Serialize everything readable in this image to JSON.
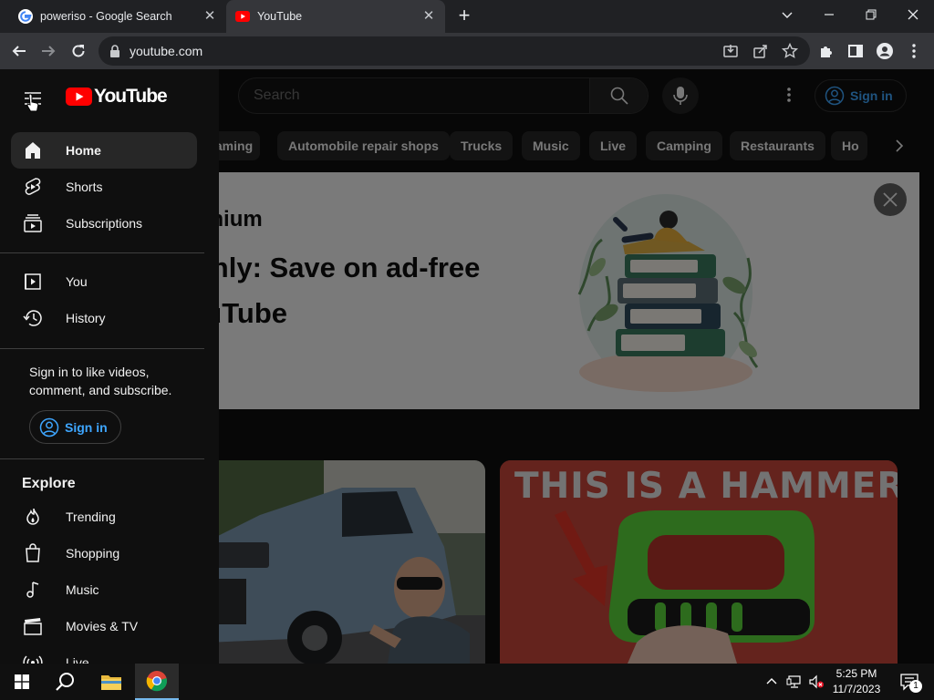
{
  "browser": {
    "tabs": [
      {
        "title": "poweriso - Google Search",
        "favicon": "google-icon"
      },
      {
        "title": "YouTube",
        "favicon": "youtube-icon",
        "active": true
      }
    ],
    "url": "youtube.com"
  },
  "youtube": {
    "logo_text": "YouTube",
    "search_placeholder": "Search",
    "signin_label": "Sign in",
    "chips": [
      "Gaming",
      "Automobile repair shops",
      "Trucks",
      "Music",
      "Live",
      "Camping",
      "Restaurants",
      "Ho"
    ],
    "banner": {
      "brand": "Premium",
      "headline": "s only: Save on ad-free YouTube"
    },
    "thumbnails": [
      {
        "caption": ""
      },
      {
        "caption": "THIS IS A HAMMER"
      }
    ]
  },
  "sidebar": {
    "primary": [
      {
        "label": "Home",
        "icon": "home-icon",
        "active": true
      },
      {
        "label": "Shorts",
        "icon": "shorts-icon"
      },
      {
        "label": "Subscriptions",
        "icon": "subscriptions-icon"
      }
    ],
    "secondary": [
      {
        "label": "You",
        "icon": "you-icon"
      },
      {
        "label": "History",
        "icon": "history-icon"
      }
    ],
    "signin_prompt": "Sign in to like videos, comment, and subscribe.",
    "signin_label": "Sign in",
    "explore_title": "Explore",
    "explore": [
      {
        "label": "Trending",
        "icon": "trending-icon"
      },
      {
        "label": "Shopping",
        "icon": "shopping-icon"
      },
      {
        "label": "Music",
        "icon": "music-icon"
      },
      {
        "label": "Movies & TV",
        "icon": "movies-icon"
      },
      {
        "label": "Live",
        "icon": "live-icon"
      }
    ]
  },
  "taskbar": {
    "time": "5:25 PM",
    "date": "11/7/2023",
    "notification_count": "1"
  },
  "colors": {
    "youtube_red": "#ff0000",
    "link_blue": "#3ea6ff",
    "page_bg": "#0f0f0f"
  }
}
